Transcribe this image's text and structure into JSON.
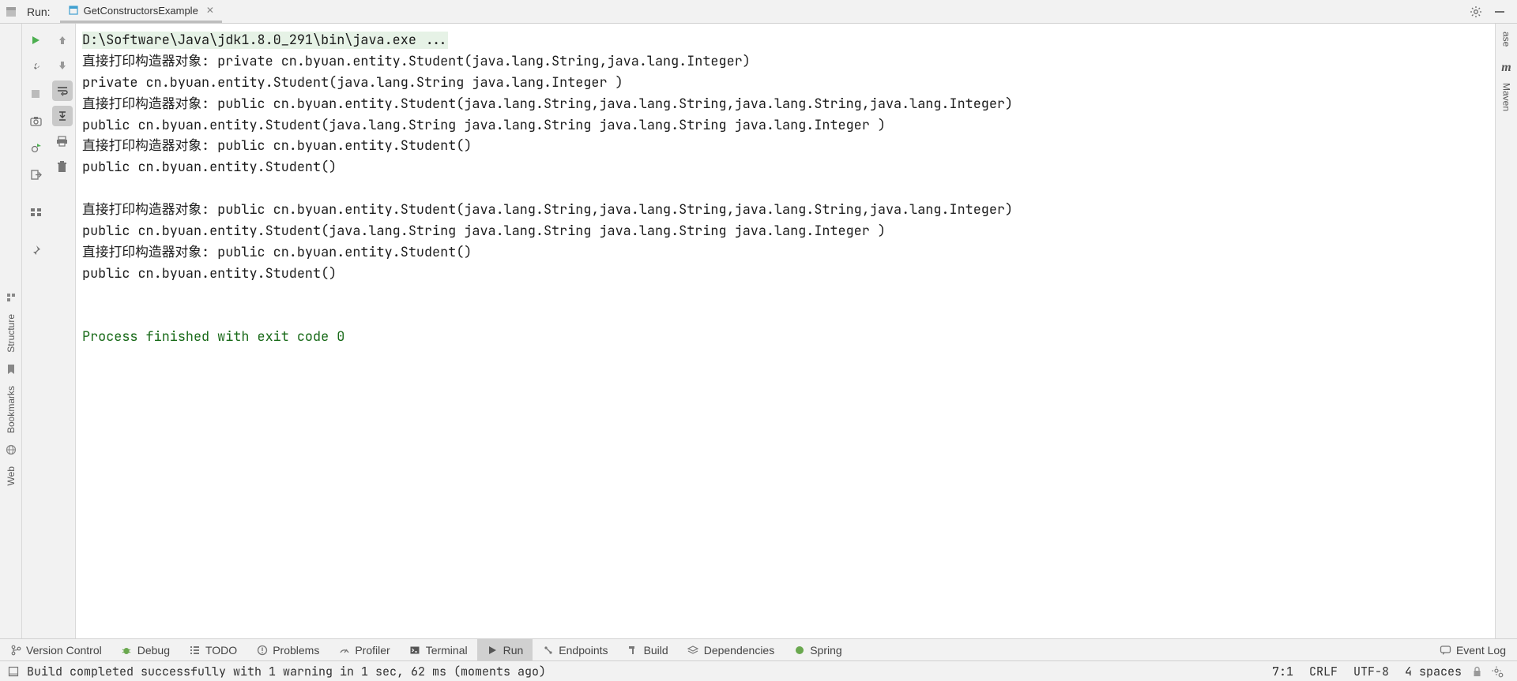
{
  "header": {
    "run_label": "Run:",
    "tab_title": "GetConstructorsExample"
  },
  "console": {
    "command": "D:\\Software\\Java\\jdk1.8.0_291\\bin\\java.exe ...",
    "lines": [
      "直接打印构造器对象: private cn.byuan.entity.Student(java.lang.String,java.lang.Integer)",
      "private cn.byuan.entity.Student(java.lang.String java.lang.Integer )",
      "直接打印构造器对象: public cn.byuan.entity.Student(java.lang.String,java.lang.String,java.lang.String,java.lang.Integer)",
      "public cn.byuan.entity.Student(java.lang.String java.lang.String java.lang.String java.lang.Integer )",
      "直接打印构造器对象: public cn.byuan.entity.Student()",
      "public cn.byuan.entity.Student()",
      "",
      "直接打印构造器对象: public cn.byuan.entity.Student(java.lang.String,java.lang.String,java.lang.String,java.lang.Integer)",
      "public cn.byuan.entity.Student(java.lang.String java.lang.String java.lang.String java.lang.Integer )",
      "直接打印构造器对象: public cn.byuan.entity.Student()",
      "public cn.byuan.entity.Student()",
      "",
      ""
    ],
    "exit_line": "Process finished with exit code 0"
  },
  "side_tabs": {
    "left": [
      "Structure",
      "Bookmarks",
      "Web"
    ],
    "right": [
      "ase",
      "Maven"
    ]
  },
  "bottom_tabs": {
    "version_control": "Version Control",
    "debug": "Debug",
    "todo": "TODO",
    "problems": "Problems",
    "profiler": "Profiler",
    "terminal": "Terminal",
    "run": "Run",
    "endpoints": "Endpoints",
    "build": "Build",
    "dependencies": "Dependencies",
    "spring": "Spring",
    "event_log": "Event Log"
  },
  "status": {
    "build_msg": "Build completed successfully with 1 warning in 1 sec, 62 ms (moments ago)",
    "caret": "7:1",
    "line_sep": "CRLF",
    "encoding": "UTF-8",
    "indent": "4 spaces"
  }
}
